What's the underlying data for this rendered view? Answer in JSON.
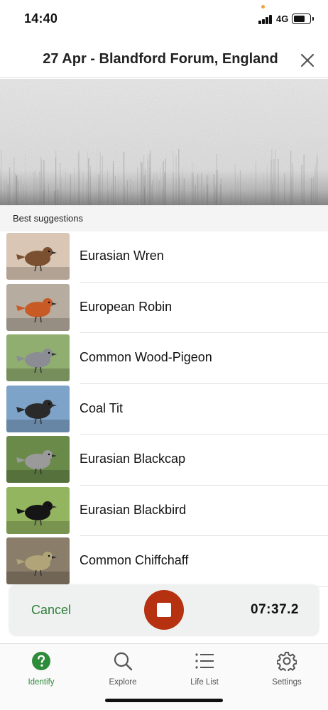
{
  "status_bar": {
    "time": "14:40",
    "network": "4G",
    "battery_level": 0.72
  },
  "header": {
    "title": "27 Apr - Blandford Forum, England",
    "close_icon": "close-icon"
  },
  "section_label": "Best suggestions",
  "suggestions": [
    {
      "name": "Eurasian Wren",
      "thumb_bg": "#d9c6b4",
      "bird": "#7a5030"
    },
    {
      "name": "European Robin",
      "thumb_bg": "#b7aca0",
      "bird": "#c85a25"
    },
    {
      "name": "Common Wood-Pigeon",
      "thumb_bg": "#8fae70",
      "bird": "#8b8c94"
    },
    {
      "name": "Coal Tit",
      "thumb_bg": "#7ea3c9",
      "bird": "#2a2a2a"
    },
    {
      "name": "Eurasian Blackcap",
      "thumb_bg": "#6a8a4a",
      "bird": "#9a9a9a"
    },
    {
      "name": "Eurasian Blackbird",
      "thumb_bg": "#93b560",
      "bird": "#151515"
    },
    {
      "name": "Common Chiffchaff",
      "thumb_bg": "#8a7d6a",
      "bird": "#b0a478"
    }
  ],
  "recording": {
    "cancel_label": "Cancel",
    "timer": "07:37.2",
    "stop_icon": "stop-icon"
  },
  "tabs": [
    {
      "label": "Identify",
      "icon": "help-circle-icon",
      "active": true
    },
    {
      "label": "Explore",
      "icon": "search-icon",
      "active": false
    },
    {
      "label": "Life List",
      "icon": "list-icon",
      "active": false
    },
    {
      "label": "Settings",
      "icon": "gear-icon",
      "active": false
    }
  ],
  "colors": {
    "accent_green": "#2e8b3a",
    "stop_red": "#b5310f"
  }
}
